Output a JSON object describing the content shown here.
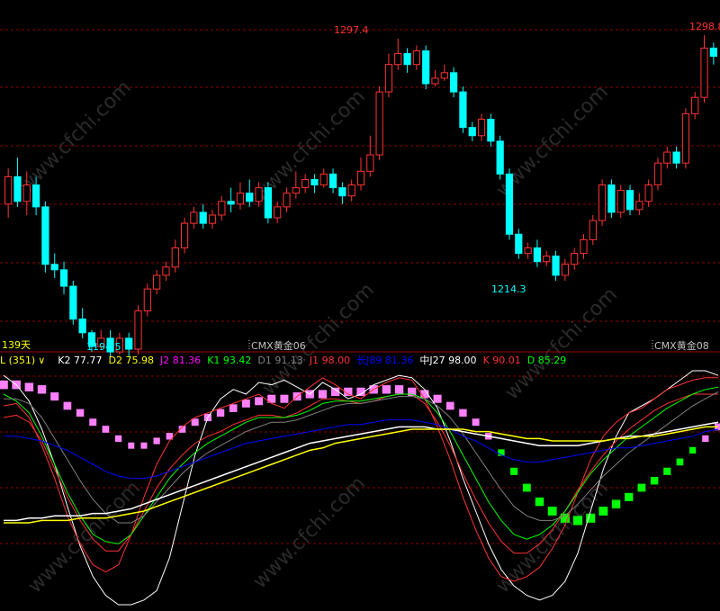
{
  "colors": {
    "up": "#ff3333",
    "down": "#00ffff",
    "grid": "#8b0000",
    "divider": "#a00000",
    "l": "#ffff00",
    "k2": "#ffffff",
    "d2": "#ffff00",
    "j2": "#ff00ff",
    "k1": "#00ff00",
    "d1": "#808080",
    "j1": "#ff3333",
    "longJ89": "#0000ff",
    "midJ27": "#ffffff",
    "k": "#ff3333",
    "d": "#00ff00",
    "posBlock": "#ff80ff",
    "negBlock": "#00ff00",
    "legendLabel": "#ffff00"
  },
  "watermark": "www.cfchi.com",
  "chart_data": [
    {
      "type": "candlestick",
      "x_markers": [
        {
          "label": "139天",
          "color": "#ffff00"
        },
        {
          "label": "CMX黄金06",
          "color": "#c0c0c0"
        },
        {
          "label": "CMX黄金08",
          "color": "#c0c0c0"
        }
      ],
      "annotations": [
        {
          "label": "1297.4",
          "color": "#ff3333"
        },
        {
          "label": "1298.8",
          "color": "#ff3333"
        },
        {
          "label": "1194.5",
          "color": "#00ffff"
        },
        {
          "label": "1214.3",
          "color": "#00ffff"
        }
      ],
      "ylim": [
        1185,
        1305
      ],
      "candles": [
        [
          1237,
          1247,
          1232,
          1250,
          1228
        ],
        [
          1247,
          1238,
          1236,
          1254,
          1232
        ],
        [
          1238,
          1244,
          1233,
          1249,
          1231
        ],
        [
          1244,
          1236,
          1233,
          1247,
          1230
        ],
        [
          1236,
          1215,
          1212,
          1238,
          1210
        ],
        [
          1215,
          1213,
          1210,
          1219,
          1208
        ],
        [
          1213,
          1207,
          1204,
          1216,
          1202
        ],
        [
          1207,
          1195,
          1193,
          1209,
          1190
        ],
        [
          1195,
          1190,
          1188,
          1199,
          1186
        ],
        [
          1190,
          1185,
          1183,
          1191,
          1180
        ],
        [
          1185,
          1188,
          1184,
          1191,
          1182
        ],
        [
          1188,
          1183,
          1181,
          1191,
          1180
        ],
        [
          1183,
          1188,
          1182,
          1190,
          1180
        ],
        [
          1188,
          1184,
          1181,
          1190,
          1179
        ],
        [
          1184,
          1198,
          1182,
          1200,
          1181
        ],
        [
          1198,
          1206,
          1196,
          1208,
          1195
        ],
        [
          1206,
          1211,
          1204,
          1213,
          1203
        ],
        [
          1211,
          1214,
          1209,
          1216,
          1207
        ],
        [
          1214,
          1221,
          1212,
          1224,
          1210
        ],
        [
          1221,
          1230,
          1219,
          1232,
          1218
        ],
        [
          1230,
          1234,
          1228,
          1236,
          1227
        ],
        [
          1234,
          1230,
          1228,
          1237,
          1226
        ],
        [
          1230,
          1233,
          1228,
          1235,
          1227
        ],
        [
          1233,
          1238,
          1231,
          1240,
          1230
        ],
        [
          1238,
          1237,
          1234,
          1243,
          1232
        ],
        [
          1237,
          1241,
          1235,
          1245,
          1233
        ],
        [
          1241,
          1238,
          1236,
          1246,
          1234
        ],
        [
          1238,
          1243,
          1236,
          1245,
          1235
        ],
        [
          1243,
          1232,
          1230,
          1245,
          1228
        ],
        [
          1232,
          1236,
          1230,
          1238,
          1229
        ],
        [
          1236,
          1241,
          1234,
          1243,
          1233
        ],
        [
          1241,
          1243,
          1239,
          1249,
          1236
        ],
        [
          1243,
          1246,
          1241,
          1248,
          1240
        ],
        [
          1246,
          1244,
          1241,
          1248,
          1238
        ],
        [
          1244,
          1248,
          1243,
          1250,
          1242
        ],
        [
          1248,
          1243,
          1241,
          1250,
          1239
        ],
        [
          1243,
          1240,
          1237,
          1245,
          1236
        ],
        [
          1240,
          1244,
          1238,
          1246,
          1237
        ],
        [
          1244,
          1249,
          1242,
          1254,
          1240
        ],
        [
          1249,
          1255,
          1247,
          1262,
          1246
        ],
        [
          1255,
          1278,
          1253,
          1280,
          1252
        ],
        [
          1278,
          1288,
          1276,
          1292,
          1275
        ],
        [
          1288,
          1292,
          1286,
          1297.4,
          1285
        ],
        [
          1292,
          1288,
          1285,
          1294,
          1283
        ],
        [
          1288,
          1293,
          1286,
          1295,
          1284
        ],
        [
          1293,
          1281,
          1279,
          1295,
          1278
        ],
        [
          1281,
          1283,
          1280,
          1286,
          1278
        ],
        [
          1283,
          1285,
          1282,
          1288,
          1280
        ],
        [
          1285,
          1278,
          1276,
          1287,
          1274
        ],
        [
          1278,
          1265,
          1263,
          1280,
          1262
        ],
        [
          1265,
          1262,
          1260,
          1267,
          1258
        ],
        [
          1262,
          1268,
          1260,
          1270,
          1259
        ],
        [
          1268,
          1260,
          1258,
          1270,
          1257
        ],
        [
          1260,
          1248,
          1246,
          1262,
          1244
        ],
        [
          1248,
          1226,
          1224,
          1250,
          1222
        ],
        [
          1226,
          1219,
          1217,
          1228,
          1216
        ],
        [
          1219,
          1221,
          1217,
          1223,
          1215
        ],
        [
          1221,
          1216,
          1214,
          1224,
          1213
        ],
        [
          1216,
          1218,
          1214.3,
          1220,
          1212
        ],
        [
          1218,
          1211,
          1209,
          1220,
          1208
        ],
        [
          1211,
          1215,
          1209,
          1217,
          1208
        ],
        [
          1215,
          1219,
          1213,
          1221,
          1212
        ],
        [
          1219,
          1224,
          1217,
          1226,
          1216
        ],
        [
          1224,
          1231,
          1222,
          1233,
          1221
        ],
        [
          1231,
          1244,
          1229,
          1246,
          1228
        ],
        [
          1244,
          1234,
          1232,
          1246,
          1230
        ],
        [
          1234,
          1242,
          1232,
          1244,
          1231
        ],
        [
          1242,
          1235,
          1233,
          1244,
          1231
        ],
        [
          1235,
          1238,
          1233,
          1241,
          1232
        ],
        [
          1238,
          1244,
          1236,
          1246,
          1235
        ],
        [
          1244,
          1252,
          1242,
          1254,
          1241
        ],
        [
          1252,
          1256,
          1250,
          1258,
          1249
        ],
        [
          1256,
          1252,
          1250,
          1258,
          1249
        ],
        [
          1252,
          1270,
          1250,
          1272,
          1249
        ],
        [
          1270,
          1276,
          1268,
          1278,
          1266
        ],
        [
          1276,
          1294,
          1274,
          1298.8,
          1273
        ],
        [
          1294,
          1291,
          1288,
          1296,
          1287
        ]
      ]
    },
    {
      "type": "line",
      "legend": [
        {
          "label": "L (351)",
          "value": "",
          "color_key": "l"
        },
        {
          "label": "K2",
          "value": "77.77",
          "color_key": "k2"
        },
        {
          "label": "D2",
          "value": "75.98",
          "color_key": "d2"
        },
        {
          "label": "J2",
          "value": "81.36",
          "color_key": "j2"
        },
        {
          "label": "K1",
          "value": "93.42",
          "color_key": "k1"
        },
        {
          "label": "D1",
          "value": "91.13",
          "color_key": "d1"
        },
        {
          "label": "J1",
          "value": "98.00",
          "color_key": "j1"
        },
        {
          "label": "长J89",
          "value": "81.36",
          "color_key": "longJ89"
        },
        {
          "label": "中J27",
          "value": "98.00",
          "color_key": "midJ27"
        },
        {
          "label": "K",
          "value": "90.01",
          "color_key": "k"
        },
        {
          "label": "D",
          "value": "85.29",
          "color_key": "d"
        }
      ],
      "ylim": [
        0,
        100
      ],
      "series": [
        {
          "color_key": "midJ27",
          "values": [
            98,
            94,
            87,
            75,
            60,
            42,
            25,
            12,
            4,
            0,
            0,
            2,
            6,
            20,
            42,
            64,
            80,
            88,
            92,
            90,
            95,
            94,
            96,
            93,
            90,
            95,
            92,
            88,
            90,
            94,
            96,
            98,
            97,
            92,
            84,
            70,
            54,
            40,
            26,
            15,
            8,
            4,
            2,
            4,
            10,
            22,
            40,
            58,
            72,
            82,
            85,
            88,
            92,
            96,
            100,
            100,
            98
          ]
        },
        {
          "color_key": "j1",
          "values": [
            85,
            86,
            80,
            68,
            54,
            38,
            26,
            17,
            14,
            17,
            30,
            46,
            60,
            70,
            76,
            80,
            82,
            84,
            86,
            88,
            90,
            86,
            84,
            89,
            93,
            97,
            94,
            90,
            88,
            92,
            95,
            97,
            96,
            88,
            76,
            62,
            46,
            32,
            20,
            12,
            10,
            12,
            16,
            24,
            34,
            48,
            62,
            72,
            78,
            82,
            84,
            88,
            92,
            94,
            96,
            97,
            97
          ]
        },
        {
          "color_key": "k",
          "values": [
            80,
            81,
            78,
            70,
            58,
            46,
            36,
            28,
            23,
            23,
            30,
            40,
            50,
            58,
            64,
            69,
            72,
            74,
            77,
            79,
            81,
            81,
            80,
            82,
            85,
            88,
            88,
            87,
            86,
            87,
            89,
            90,
            90,
            86,
            78,
            68,
            56,
            45,
            35,
            27,
            22,
            22,
            26,
            32,
            40,
            49,
            57,
            64,
            70,
            75,
            79,
            83,
            86,
            88,
            90,
            90,
            90
          ]
        },
        {
          "color_key": "k1",
          "values": [
            90,
            87,
            82,
            72,
            60,
            48,
            38,
            30,
            27,
            26,
            30,
            38,
            46,
            54,
            60,
            65,
            69,
            72,
            75,
            78,
            80,
            80,
            80,
            81,
            83,
            86,
            87,
            87,
            87,
            88,
            89,
            90,
            90,
            88,
            82,
            74,
            64,
            54,
            44,
            36,
            30,
            28,
            30,
            34,
            40,
            48,
            56,
            62,
            67,
            72,
            76,
            80,
            84,
            87,
            90,
            92,
            93
          ]
        },
        {
          "color_key": "d1",
          "values": [
            88,
            88,
            86,
            80,
            71,
            62,
            53,
            45,
            39,
            35,
            35,
            38,
            44,
            50,
            56,
            61,
            65,
            68,
            71,
            74,
            76,
            78,
            78,
            79,
            81,
            83,
            85,
            86,
            86,
            87,
            88,
            89,
            89,
            88,
            85,
            80,
            73,
            65,
            57,
            49,
            42,
            38,
            36,
            36,
            38,
            43,
            49,
            55,
            60,
            65,
            69,
            73,
            77,
            81,
            85,
            88,
            91
          ]
        },
        {
          "color_key": "longJ89",
          "values": [
            72,
            72,
            71,
            70,
            68,
            66,
            63,
            60,
            57,
            55,
            54,
            54,
            55,
            57,
            59,
            61,
            63,
            65,
            67,
            69,
            70,
            71,
            72,
            73,
            74,
            75,
            76,
            77,
            77,
            78,
            79,
            79,
            79,
            78,
            77,
            75,
            72,
            70,
            67,
            64,
            62,
            61,
            61,
            62,
            63,
            64,
            65,
            66,
            67,
            67,
            68,
            69,
            70,
            71,
            72,
            74,
            75
          ]
        },
        {
          "color_key": "k2",
          "values": [
            36,
            36,
            37,
            37,
            38,
            38,
            38,
            39,
            39,
            40,
            41,
            43,
            45,
            47,
            49,
            51,
            53,
            55,
            57,
            59,
            61,
            63,
            65,
            67,
            69,
            70,
            71,
            72,
            73,
            74,
            75,
            76,
            76,
            76,
            75,
            75,
            74,
            73,
            72,
            71,
            70,
            69,
            68,
            68,
            68,
            68,
            69,
            70,
            71,
            72,
            72,
            73,
            74,
            75,
            76,
            77,
            78
          ]
        },
        {
          "color_key": "d2",
          "values": [
            35,
            35,
            35,
            36,
            36,
            36,
            37,
            37,
            37,
            38,
            39,
            40,
            42,
            44,
            46,
            48,
            50,
            52,
            54,
            56,
            58,
            60,
            62,
            64,
            66,
            67,
            69,
            70,
            71,
            72,
            73,
            74,
            75,
            75,
            75,
            75,
            75,
            74,
            74,
            73,
            72,
            71,
            71,
            70,
            70,
            70,
            70,
            70,
            71,
            71,
            72,
            72,
            73,
            74,
            75,
            76,
            76
          ]
        }
      ],
      "histogram": {
        "baseline": 68,
        "values": [
          94,
          94,
          93,
          92,
          89,
          85,
          82,
          78,
          75,
          71,
          68,
          68,
          70,
          72,
          75,
          78,
          80,
          82,
          84,
          86,
          87,
          88,
          88,
          89,
          90,
          90,
          91,
          91,
          91,
          92,
          92,
          92,
          91,
          90,
          88,
          85,
          82,
          78,
          72,
          65,
          57,
          50,
          44,
          40,
          37,
          36,
          37,
          40,
          43,
          46,
          50,
          53,
          57,
          61,
          66,
          71,
          76
        ]
      }
    }
  ]
}
